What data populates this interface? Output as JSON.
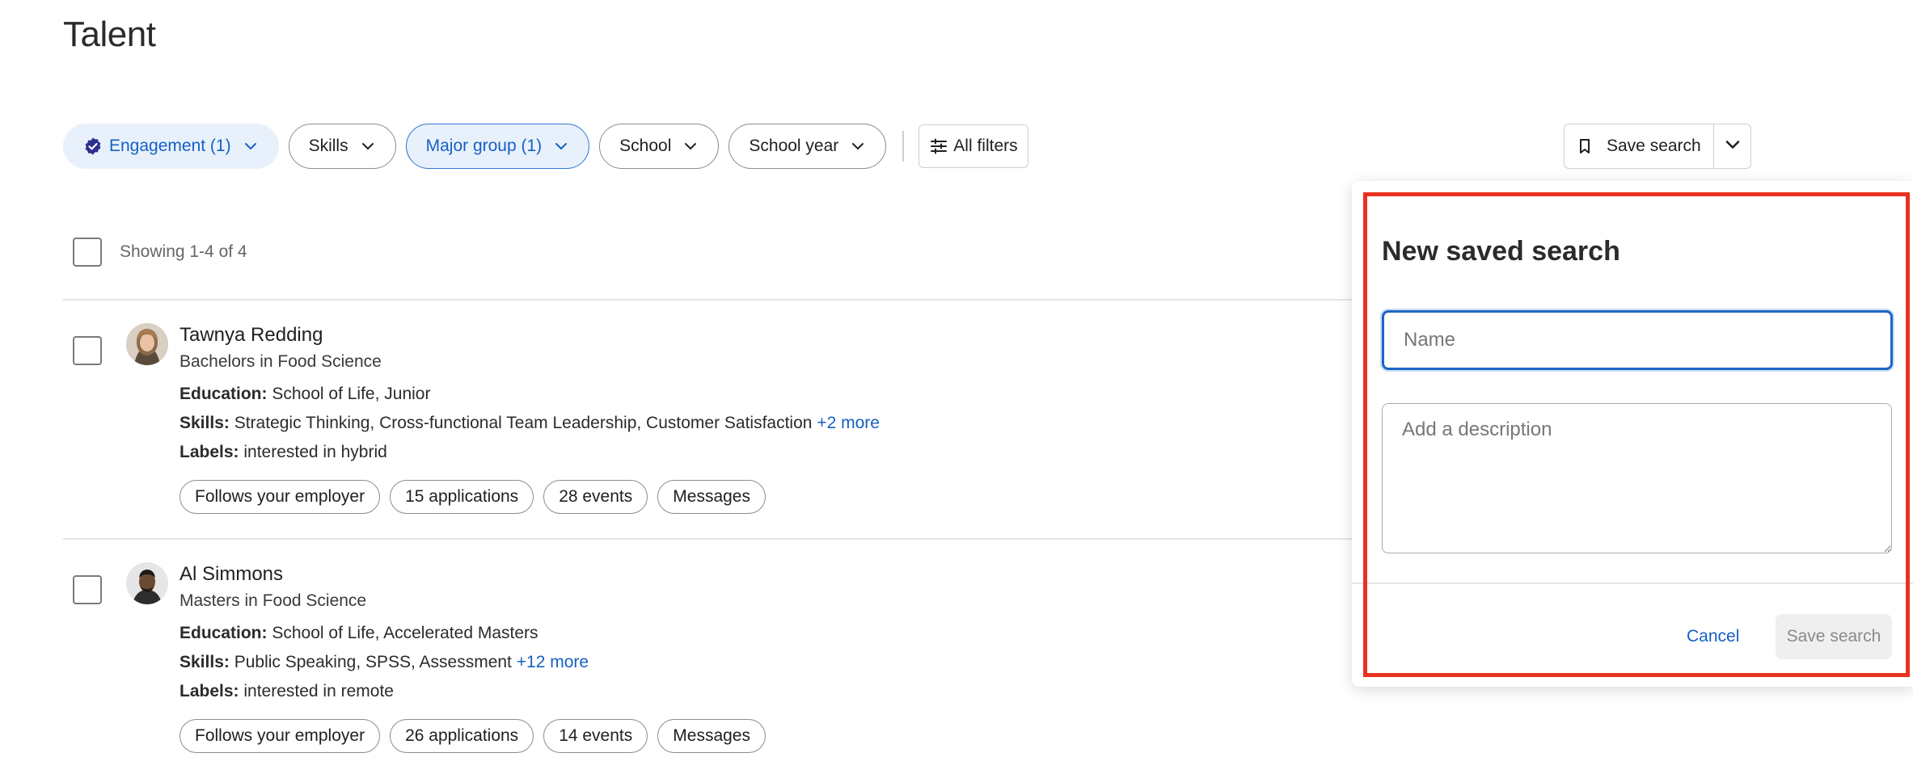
{
  "page": {
    "title": "Talent"
  },
  "filters": {
    "engagement": "Engagement (1)",
    "skills": "Skills",
    "major_group": "Major group (1)",
    "school": "School",
    "school_year": "School year",
    "all_filters": "All filters"
  },
  "save_search": {
    "label": "Save search"
  },
  "list": {
    "count_text": "Showing 1-4 of 4",
    "candidates": [
      {
        "name": "Tawnya Redding",
        "degree": "Bachelors in Food Science",
        "education_label": "Education:",
        "education": "School of Life, Junior",
        "skills_label": "Skills:",
        "skills": "Strategic Thinking, Cross-functional Team Leadership, Customer Satisfaction",
        "skills_more": "+2 more",
        "labels_label": "Labels:",
        "labels": "interested in hybrid",
        "tags": [
          "Follows your employer",
          "15 applications",
          "28 events",
          "Messages"
        ]
      },
      {
        "name": "Al Simmons",
        "degree": "Masters in Food Science",
        "education_label": "Education:",
        "education": "School of Life, Accelerated Masters",
        "skills_label": "Skills:",
        "skills": "Public Speaking, SPSS, Assessment",
        "skills_more": "+12 more",
        "labels_label": "Labels:",
        "labels": "interested in remote",
        "tags": [
          "Follows your employer",
          "26 applications",
          "14 events",
          "Messages"
        ]
      }
    ]
  },
  "modal": {
    "title": "New saved search",
    "name_placeholder": "Name",
    "description_placeholder": "Add a description",
    "cancel": "Cancel",
    "save": "Save search"
  },
  "colors": {
    "accent": "#1660c4",
    "highlight": "#e8321f",
    "active_fill": "#e8f1fb"
  }
}
